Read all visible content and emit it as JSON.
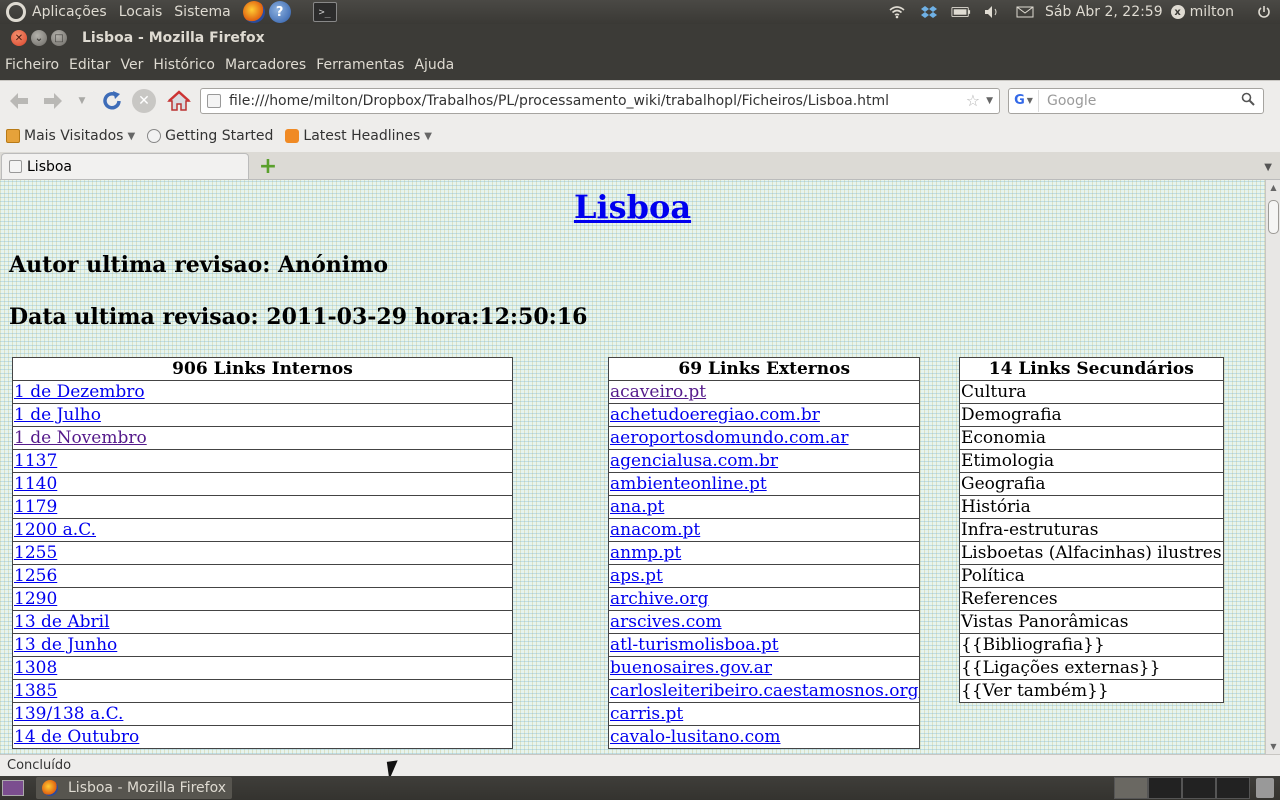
{
  "top_panel": {
    "menus": [
      "Aplicações",
      "Locais",
      "Sistema"
    ],
    "clock": "Sáb Abr  2, 22:59",
    "user": "milton",
    "icons": [
      "ubuntu-logo-icon",
      "firefox-launcher-icon",
      "help-icon",
      "terminal-icon",
      "wifi-icon",
      "dropbox-icon",
      "battery-icon",
      "volume-icon",
      "mail-icon",
      "power-icon"
    ]
  },
  "window": {
    "title": "Lisboa - Mozilla Firefox"
  },
  "menubar": [
    "Ficheiro",
    "Editar",
    "Ver",
    "Histórico",
    "Marcadores",
    "Ferramentas",
    "Ajuda"
  ],
  "navbar": {
    "url": "file:///home/milton/Dropbox/Trabalhos/PL/processamento_wiki/trabalhopl/Ficheiros/Lisboa.html",
    "search_placeholder": "Google",
    "engine_label": "G"
  },
  "bookmarks": [
    {
      "label": "Mais Visitados",
      "dropdown": true
    },
    {
      "label": "Getting Started",
      "dropdown": false
    },
    {
      "label": "Latest Headlines",
      "dropdown": true
    }
  ],
  "tabs": [
    {
      "label": "Lisboa"
    }
  ],
  "page": {
    "title": "Lisboa",
    "author_line": "Autor ultima revisao: Anónimo",
    "date_line": "Data ultima revisao: 2011-03-29 hora:12:50:16",
    "internal_links": {
      "header": "906 Links Internos",
      "items": [
        {
          "text": "1 de Dezembro",
          "visited": false
        },
        {
          "text": "1 de Julho",
          "visited": false
        },
        {
          "text": "1 de Novembro",
          "visited": true
        },
        {
          "text": "1137",
          "visited": false
        },
        {
          "text": "1140",
          "visited": false
        },
        {
          "text": "1179",
          "visited": false
        },
        {
          "text": "1200 a.C.",
          "visited": false
        },
        {
          "text": "1255",
          "visited": false
        },
        {
          "text": "1256",
          "visited": false
        },
        {
          "text": "1290",
          "visited": false
        },
        {
          "text": "13 de Abril",
          "visited": false
        },
        {
          "text": "13 de Junho",
          "visited": false
        },
        {
          "text": "1308",
          "visited": false
        },
        {
          "text": "1385",
          "visited": false
        },
        {
          "text": "139/138 a.C.",
          "visited": false
        },
        {
          "text": "14 de Outubro",
          "visited": false
        }
      ]
    },
    "external_links": {
      "header": "69 Links Externos",
      "items": [
        {
          "text": "acaveiro.pt",
          "visited": true
        },
        {
          "text": "achetudoeregiao.com.br",
          "visited": false
        },
        {
          "text": "aeroportosdomundo.com.ar",
          "visited": false
        },
        {
          "text": "agencialusa.com.br",
          "visited": false
        },
        {
          "text": "ambienteonline.pt",
          "visited": false
        },
        {
          "text": "ana.pt",
          "visited": false
        },
        {
          "text": "anacom.pt",
          "visited": false
        },
        {
          "text": "anmp.pt",
          "visited": false
        },
        {
          "text": "aps.pt",
          "visited": false
        },
        {
          "text": "archive.org",
          "visited": false
        },
        {
          "text": "arscives.com",
          "visited": false
        },
        {
          "text": "atl-turismolisboa.pt",
          "visited": false
        },
        {
          "text": "buenosaires.gov.ar",
          "visited": false
        },
        {
          "text": "carlosleiteribeiro.caestamosnos.org",
          "visited": false
        },
        {
          "text": "carris.pt",
          "visited": false
        },
        {
          "text": "cavalo-lusitano.com",
          "visited": false
        }
      ]
    },
    "secondary_links": {
      "header": "14 Links Secundários",
      "items": [
        "Cultura",
        "Demografia",
        "Economia",
        "Etimologia",
        "Geografia",
        "História",
        "Infra-estruturas",
        "Lisboetas (Alfacinhas) ilustres",
        "Política",
        "References",
        "Vistas Panorâmicas",
        "{{Bibliografia}}",
        "{{Ligações externas}}",
        "{{Ver também}}"
      ]
    }
  },
  "statusbar": {
    "text": "Concluído"
  },
  "taskbar": {
    "items": [
      "Lisboa - Mozilla Firefox"
    ]
  },
  "colors": {
    "link": "#0000ee",
    "visited_link": "#551a8b",
    "panel_bg": "#3c3b37",
    "panel_text": "#dfdbd2"
  }
}
